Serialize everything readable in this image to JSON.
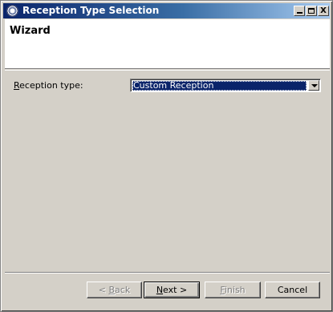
{
  "window": {
    "title": "Reception Type Selection",
    "controls": {
      "minimize": "_",
      "maximize": "□",
      "close": "X"
    }
  },
  "banner": {
    "title": "Wizard"
  },
  "form": {
    "reception_type": {
      "label_mnemonic": "R",
      "label_rest": "eception type:",
      "value": "Custom Reception"
    }
  },
  "buttons": {
    "back": {
      "prefix": "< ",
      "mnemonic": "B",
      "rest": "ack",
      "enabled": false
    },
    "next": {
      "prefix": "",
      "mnemonic": "N",
      "rest": "ext >",
      "enabled": true,
      "default": true
    },
    "finish": {
      "prefix": "",
      "mnemonic": "F",
      "rest": "inish",
      "enabled": false
    },
    "cancel": {
      "label": "Cancel",
      "enabled": true
    }
  },
  "colors": {
    "titlebar_start": "#0a246a",
    "titlebar_end": "#a6caf0",
    "dialog_bg": "#d4d0c8",
    "selection": "#0a246a"
  },
  "icons": {
    "app": "eclipse-icon",
    "combo_arrow": "chevron-down-icon"
  }
}
